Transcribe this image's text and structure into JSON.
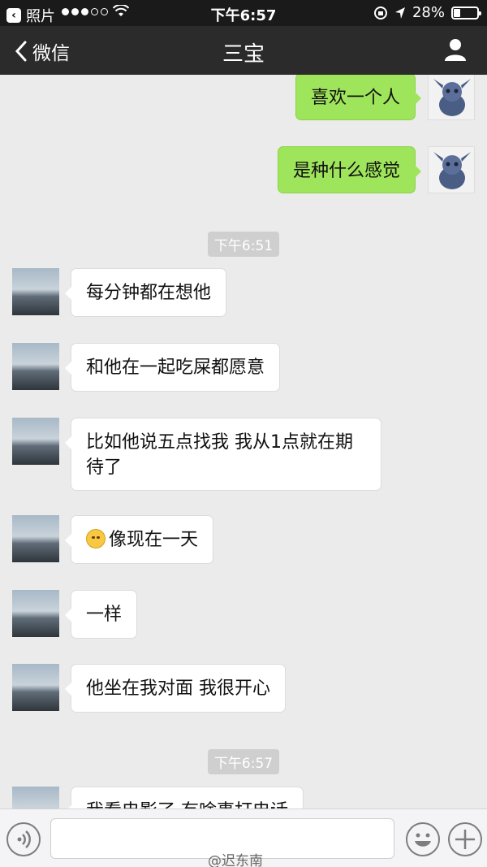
{
  "status_bar": {
    "back_app": "照片",
    "time": "下午6:57",
    "battery": "28%",
    "battery_level": 0.28,
    "signal_dots_filled": 3,
    "signal_dots_total": 5
  },
  "nav": {
    "back_label": "微信",
    "title": "三宝",
    "icons": {
      "back": "chevron-left-icon",
      "profile": "person-icon"
    }
  },
  "messages": [
    {
      "type": "text",
      "sender": "self",
      "text": "喜欢一个人"
    },
    {
      "type": "text",
      "sender": "self",
      "text": "是种什么感觉"
    },
    {
      "type": "timestamp",
      "text": "下午6:51"
    },
    {
      "type": "text",
      "sender": "other",
      "text": "每分钟都在想他"
    },
    {
      "type": "text",
      "sender": "other",
      "text": "和他在一起吃屎都愿意"
    },
    {
      "type": "text",
      "sender": "other",
      "text": "比如他说五点找我 我从1点就在期待了"
    },
    {
      "type": "text",
      "sender": "other",
      "text": "像现在一天",
      "emoji": "smile-emoji"
    },
    {
      "type": "text",
      "sender": "other",
      "text": "一样"
    },
    {
      "type": "text",
      "sender": "other",
      "text": "他坐在我对面 我很开心"
    },
    {
      "type": "timestamp",
      "text": "下午6:57"
    },
    {
      "type": "text",
      "sender": "other",
      "text": "我看电影了 有啥事打电话"
    }
  ],
  "input_bar": {
    "icons": {
      "voice": "voice-icon",
      "emoji": "emoji-icon",
      "more": "plus-icon"
    },
    "placeholder": ""
  },
  "watermark": "@迟东南",
  "colors": {
    "self_bubble": "#9fe55b",
    "other_bubble": "#ffffff",
    "nav_bg": "#2b2b2b",
    "chat_bg": "#ebebeb"
  }
}
